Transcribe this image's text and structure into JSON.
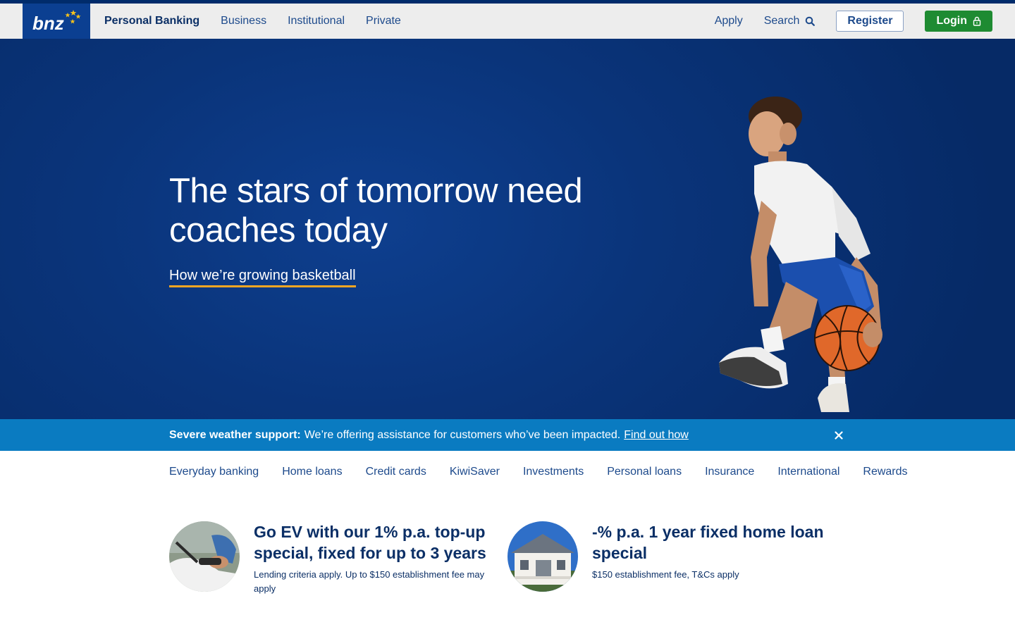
{
  "header": {
    "logo_text": "bnz",
    "nav": [
      "Personal Banking",
      "Business",
      "Institutional",
      "Private"
    ],
    "apply_label": "Apply",
    "search_label": "Search",
    "register_label": "Register",
    "login_label": "Login"
  },
  "hero": {
    "title_line1": "The stars of tomorrow need",
    "title_line2": "coaches today",
    "link_label": "How we’re growing basketball"
  },
  "alert": {
    "bold": "Severe weather support:",
    "message": "We’re offering assistance for customers who’ve been impacted.",
    "link": "Find out how"
  },
  "products": [
    "Everyday banking",
    "Home loans",
    "Credit cards",
    "KiwiSaver",
    "Investments",
    "Personal loans",
    "Insurance",
    "International",
    "Rewards"
  ],
  "promos": [
    {
      "title": "Go EV with our 1% p.a. top-up special, fixed for up to 3 years",
      "subtitle": "Lending criteria apply. Up to $150 establishment fee may apply"
    },
    {
      "title": "-% p.a. 1 year fixed home loan special",
      "subtitle": "$150 establishment fee, T&Cs apply"
    }
  ],
  "colors": {
    "brand_navy": "#0b3f91",
    "hero_blue": "#0a347a",
    "alert_blue": "#0a7bc1",
    "login_green": "#1e8b32",
    "link_underline": "#f5a623"
  }
}
